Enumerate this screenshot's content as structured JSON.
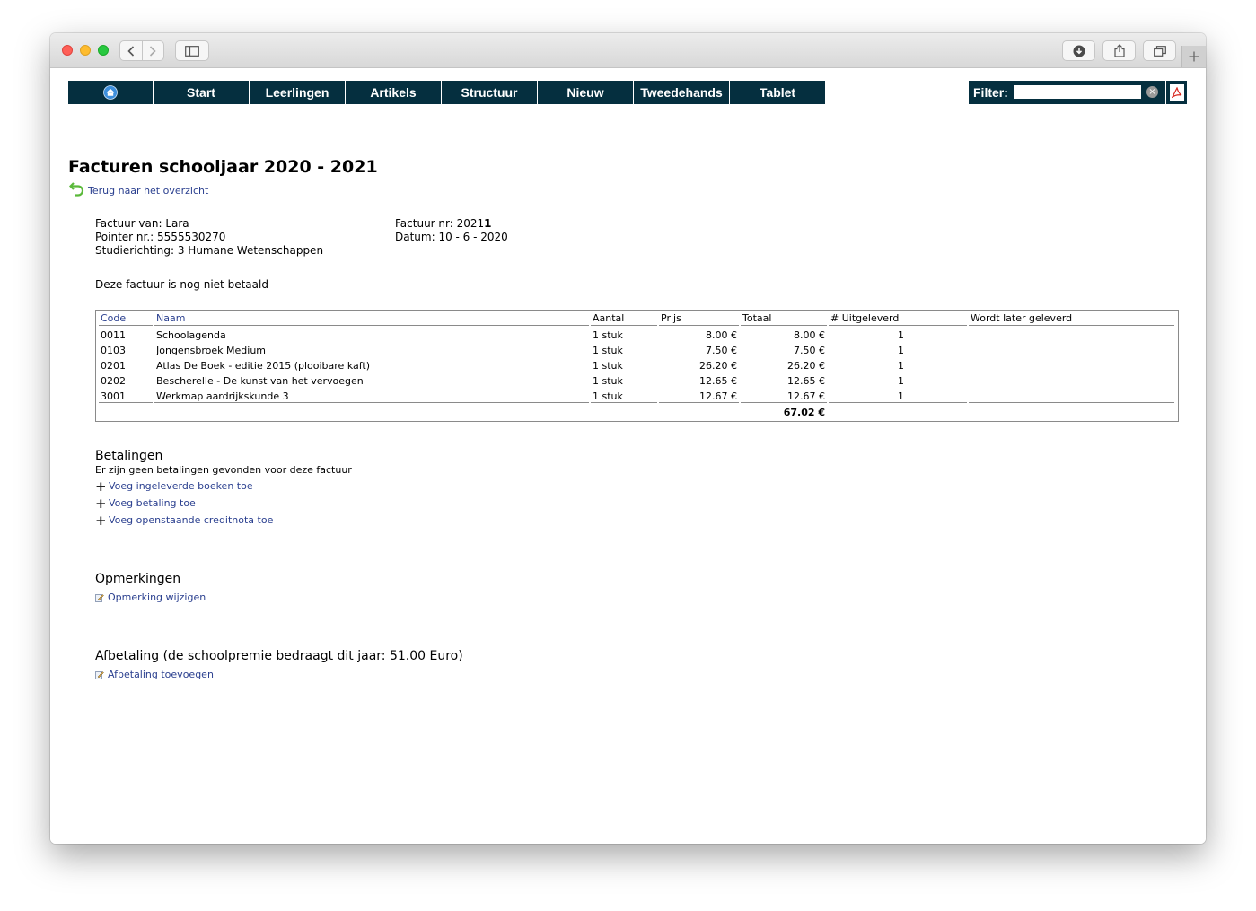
{
  "nav": {
    "items": [
      "Start",
      "Leerlingen",
      "Artikels",
      "Structuur",
      "Nieuw",
      "Tweedehands",
      "Tablet"
    ],
    "filter_label": "Filter:",
    "filter_value": ""
  },
  "page": {
    "title": "Facturen schooljaar 2020 - 2021",
    "back_link": "Terug naar het overzicht"
  },
  "invoice": {
    "factuur_van": "Factuur van: Lara",
    "pointer_nr": "Pointer nr.: 5555530270",
    "studierichting": "Studierichting: 3 Humane Wetenschappen",
    "factuur_nr_label": "Factuur nr: 2021",
    "factuur_nr_bold": "1",
    "datum": "Datum: 10 - 6 - 2020",
    "status": "Deze factuur is nog niet betaald"
  },
  "table": {
    "headers": [
      "Code",
      "Naam",
      "Aantal",
      "Prijs",
      "Totaal",
      "# Uitgeleverd",
      "Wordt later geleverd"
    ],
    "rows": [
      [
        "0011",
        "Schoolagenda",
        "1 stuk",
        "8.00 €",
        "8.00 €",
        "1",
        ""
      ],
      [
        "0103",
        "Jongensbroek Medium",
        "1 stuk",
        "7.50 €",
        "7.50 €",
        "1",
        ""
      ],
      [
        "0201",
        "Atlas De Boek - editie 2015 (plooibare kaft)",
        "1 stuk",
        "26.20 €",
        "26.20 €",
        "1",
        ""
      ],
      [
        "0202",
        "Bescherelle - De kunst van het vervoegen",
        "1 stuk",
        "12.65 €",
        "12.65 €",
        "1",
        ""
      ],
      [
        "3001",
        "Werkmap aardrijkskunde 3",
        "1 stuk",
        "12.67 €",
        "12.67 €",
        "1",
        ""
      ]
    ],
    "grand_total": "67.02 €"
  },
  "betalingen": {
    "title": "Betalingen",
    "none_text": "Er zijn geen betalingen gevonden voor deze factuur",
    "actions": [
      "Voeg ingeleverde boeken toe",
      "Voeg betaling toe",
      "Voeg openstaande creditnota toe"
    ]
  },
  "opmerkingen": {
    "title": "Opmerkingen",
    "edit_link": "Opmerking wijzigen"
  },
  "afbetaling": {
    "title": "Afbetaling (de schoolpremie bedraagt dit jaar: 51.00 Euro)",
    "add_link": "Afbetaling toevoegen"
  }
}
